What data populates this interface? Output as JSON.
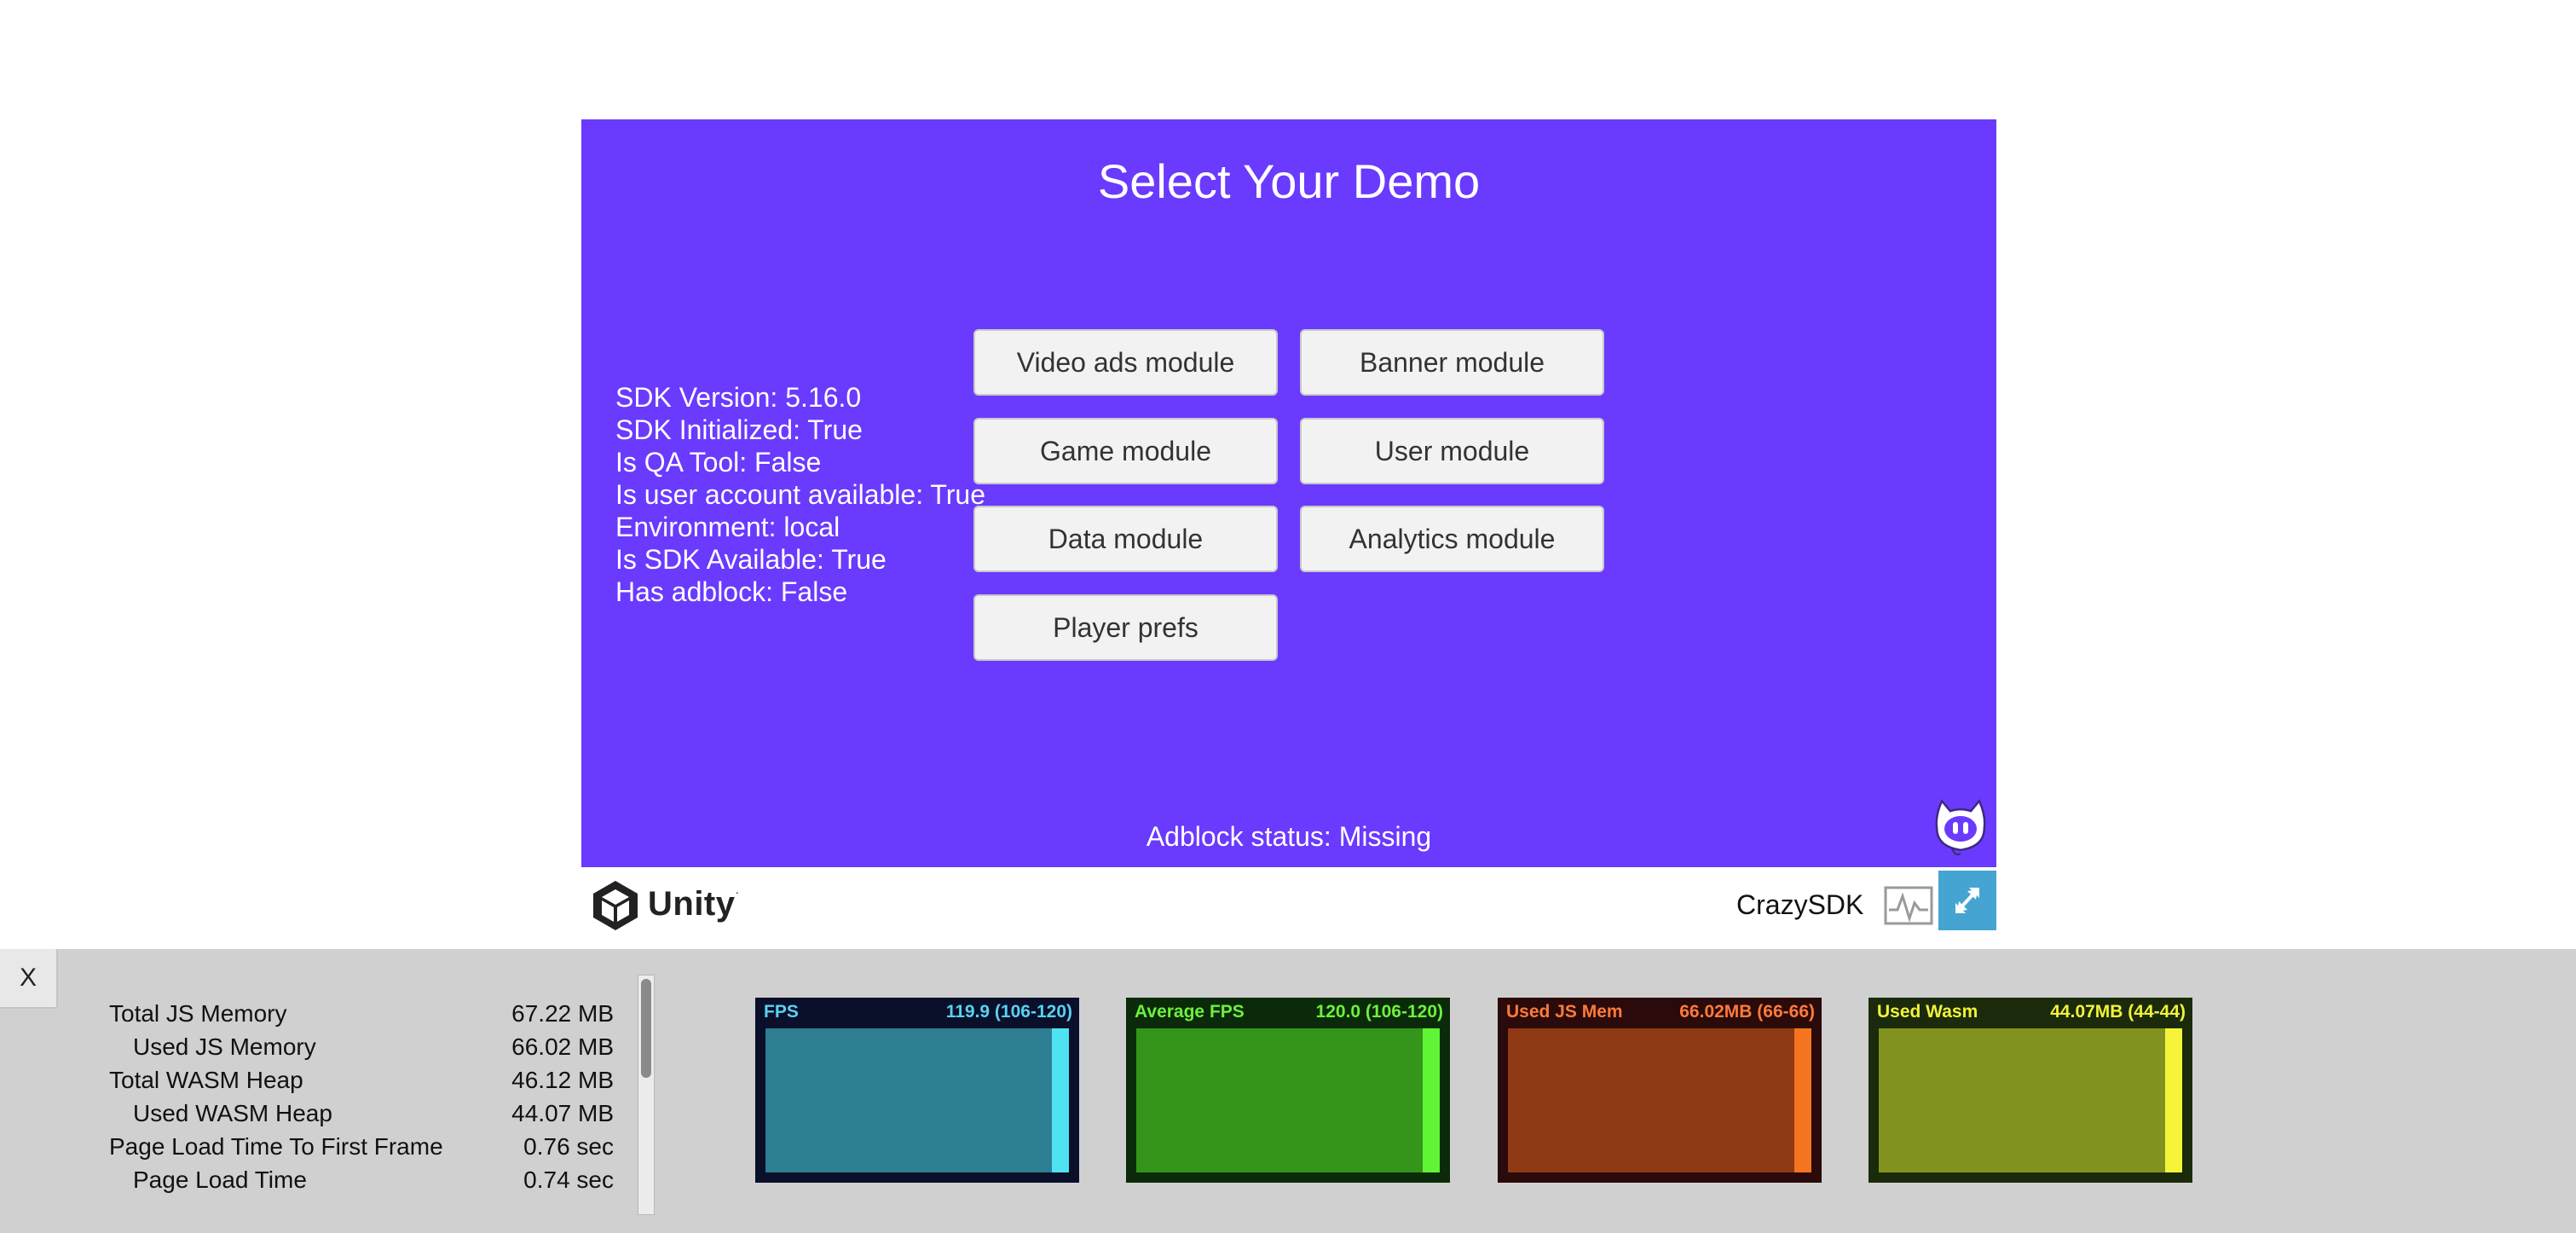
{
  "game": {
    "title": "Select Your Demo",
    "info_lines": [
      "SDK Version: 5.16.0",
      "SDK Initialized: True",
      "Is QA Tool: False",
      "Is user account available: True",
      "Environment: local",
      "Is SDK Available: True",
      "Has adblock: False"
    ],
    "buttons": {
      "video_ads": "Video ads module",
      "banner": "Banner module",
      "game": "Game module",
      "user": "User module",
      "data": "Data module",
      "analytics": "Analytics module",
      "player_prefs": "Player prefs"
    },
    "adblock_status": "Adblock status: Missing",
    "background_color": "#6a3afe"
  },
  "footer": {
    "logo_text": "Unity",
    "logo_mark": "·",
    "build_name": "CrazySDK",
    "metrics_icon": "activity-chart-icon",
    "fullscreen_icon": "expand-arrows-icon"
  },
  "diagnostics": {
    "close_label": "X",
    "stats": [
      {
        "label": "Total JS Memory",
        "value": "67.22 MB"
      },
      {
        "label": "Used JS Memory",
        "value": "66.02 MB"
      },
      {
        "label": "Total WASM Heap",
        "value": "46.12 MB"
      },
      {
        "label": "Used WASM Heap",
        "value": "44.07 MB"
      },
      {
        "label": "Page Load Time To First Frame",
        "value": "0.76 sec"
      },
      {
        "label": "Page Load Time",
        "value": "0.74 sec"
      }
    ],
    "graphs": [
      {
        "title": "FPS",
        "value": "119.9 (106-120)",
        "text_color": "#5ad1f0",
        "fill_color": "#2e7e94",
        "bar_color": "#4fe3f2",
        "border_color": "#0a0f2a"
      },
      {
        "title": "Average FPS",
        "value": "120.0 (106-120)",
        "text_color": "#6ef03c",
        "fill_color": "#35941a",
        "bar_color": "#5ff534",
        "border_color": "#0a2a0a"
      },
      {
        "title": "Used JS Mem",
        "value": "66.02MB (66-66)",
        "text_color": "#ff7a3a",
        "fill_color": "#8f3a14",
        "bar_color": "#f4741f",
        "border_color": "#2a0a0a"
      },
      {
        "title": "Used Wasm",
        "value": "44.07MB (44-44)",
        "text_color": "#f2f23a",
        "fill_color": "#82921f",
        "bar_color": "#f4f43a",
        "border_color": "#1a2a0a"
      }
    ]
  }
}
